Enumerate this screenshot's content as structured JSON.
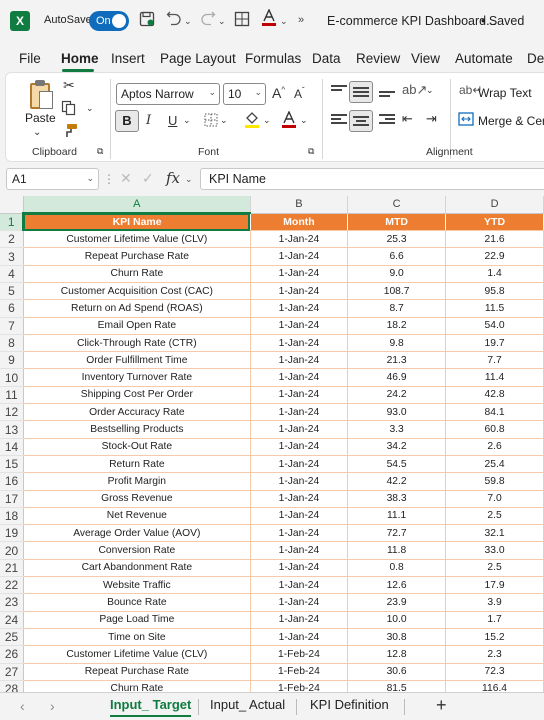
{
  "titlebar": {
    "logo": "X",
    "autosave_label": "AutoSave",
    "autosave_state": "On",
    "doc_title": "E-commerce KPI Dashboard...",
    "save_status": "• Saved",
    "icons": [
      "excel-logo-icon",
      "save-icon",
      "undo-icon",
      "redo-icon",
      "table-icon",
      "font-color-icon"
    ]
  },
  "menu": {
    "tabs": [
      "File",
      "Home",
      "Insert",
      "Page Layout",
      "Formulas",
      "Data",
      "Review",
      "View",
      "Automate",
      "Dev"
    ],
    "active": "Home"
  },
  "ribbon": {
    "clipboard": {
      "paste_label": "Paste",
      "group_label": "Clipboard"
    },
    "font": {
      "family": "Aptos Narrow",
      "size": "10",
      "bold": "B",
      "italic": "I",
      "underline": "U",
      "group_label": "Font"
    },
    "alignment": {
      "wrap_text": "Wrap Text",
      "merge_center": "Merge & Cent",
      "group_label": "Alignment"
    }
  },
  "formula_bar": {
    "name_box": "A1",
    "fx": "fx",
    "content": "KPI Name"
  },
  "sheet": {
    "columns": [
      "A",
      "B",
      "C",
      "D"
    ],
    "selected_column": "A",
    "selected_row": "1",
    "header_row": {
      "num": "1",
      "cells": [
        "KPI Name",
        "Month",
        "MTD",
        "YTD"
      ]
    },
    "rows": [
      {
        "num": "2",
        "cells": [
          "Customer Lifetime Value (CLV)",
          "1-Jan-24",
          "25.3",
          "21.6"
        ]
      },
      {
        "num": "3",
        "cells": [
          "Repeat Purchase Rate",
          "1-Jan-24",
          "6.6",
          "22.9"
        ]
      },
      {
        "num": "4",
        "cells": [
          "Churn Rate",
          "1-Jan-24",
          "9.0",
          "1.4"
        ]
      },
      {
        "num": "5",
        "cells": [
          "Customer Acquisition Cost (CAC)",
          "1-Jan-24",
          "108.7",
          "95.8"
        ]
      },
      {
        "num": "6",
        "cells": [
          "Return on Ad Spend (ROAS)",
          "1-Jan-24",
          "8.7",
          "11.5"
        ]
      },
      {
        "num": "7",
        "cells": [
          "Email Open Rate",
          "1-Jan-24",
          "18.2",
          "54.0"
        ]
      },
      {
        "num": "8",
        "cells": [
          "Click-Through Rate (CTR)",
          "1-Jan-24",
          "9.8",
          "19.7"
        ]
      },
      {
        "num": "9",
        "cells": [
          "Order Fulfillment Time",
          "1-Jan-24",
          "21.3",
          "7.7"
        ]
      },
      {
        "num": "10",
        "cells": [
          "Inventory Turnover Rate",
          "1-Jan-24",
          "46.9",
          "11.4"
        ]
      },
      {
        "num": "11",
        "cells": [
          "Shipping Cost Per Order",
          "1-Jan-24",
          "24.2",
          "42.8"
        ]
      },
      {
        "num": "12",
        "cells": [
          "Order Accuracy Rate",
          "1-Jan-24",
          "93.0",
          "84.1"
        ]
      },
      {
        "num": "13",
        "cells": [
          "Bestselling Products",
          "1-Jan-24",
          "3.3",
          "60.8"
        ]
      },
      {
        "num": "14",
        "cells": [
          "Stock-Out Rate",
          "1-Jan-24",
          "34.2",
          "2.6"
        ]
      },
      {
        "num": "15",
        "cells": [
          "Return Rate",
          "1-Jan-24",
          "54.5",
          "25.4"
        ]
      },
      {
        "num": "16",
        "cells": [
          "Profit Margin",
          "1-Jan-24",
          "42.2",
          "59.8"
        ]
      },
      {
        "num": "17",
        "cells": [
          "Gross Revenue",
          "1-Jan-24",
          "38.3",
          "7.0"
        ]
      },
      {
        "num": "18",
        "cells": [
          "Net Revenue",
          "1-Jan-24",
          "11.1",
          "2.5"
        ]
      },
      {
        "num": "19",
        "cells": [
          "Average Order Value (AOV)",
          "1-Jan-24",
          "72.7",
          "32.1"
        ]
      },
      {
        "num": "20",
        "cells": [
          "Conversion Rate",
          "1-Jan-24",
          "11.8",
          "33.0"
        ]
      },
      {
        "num": "21",
        "cells": [
          "Cart Abandonment Rate",
          "1-Jan-24",
          "0.8",
          "2.5"
        ]
      },
      {
        "num": "22",
        "cells": [
          "Website Traffic",
          "1-Jan-24",
          "12.6",
          "17.9"
        ]
      },
      {
        "num": "23",
        "cells": [
          "Bounce Rate",
          "1-Jan-24",
          "23.9",
          "3.9"
        ]
      },
      {
        "num": "24",
        "cells": [
          "Page Load Time",
          "1-Jan-24",
          "10.0",
          "1.7"
        ]
      },
      {
        "num": "25",
        "cells": [
          "Time on Site",
          "1-Jan-24",
          "30.8",
          "15.2"
        ]
      },
      {
        "num": "26",
        "cells": [
          "Customer Lifetime Value (CLV)",
          "1-Feb-24",
          "12.8",
          "2.3"
        ]
      },
      {
        "num": "27",
        "cells": [
          "Repeat Purchase Rate",
          "1-Feb-24",
          "30.6",
          "72.3"
        ]
      },
      {
        "num": "28",
        "cells": [
          "Churn Rate",
          "1-Feb-24",
          "81.5",
          "116.4"
        ]
      }
    ]
  },
  "sheet_tabs": {
    "tabs": [
      "Input_ Target",
      "Input_ Actual",
      "KPI Definition"
    ],
    "active": "Input_ Target",
    "add": "+"
  },
  "colors": {
    "excel_green": "#107c41",
    "header_fill": "#ed7d31",
    "grid_line": "#f6c9a8",
    "toggle_blue": "#0f6cbd"
  }
}
